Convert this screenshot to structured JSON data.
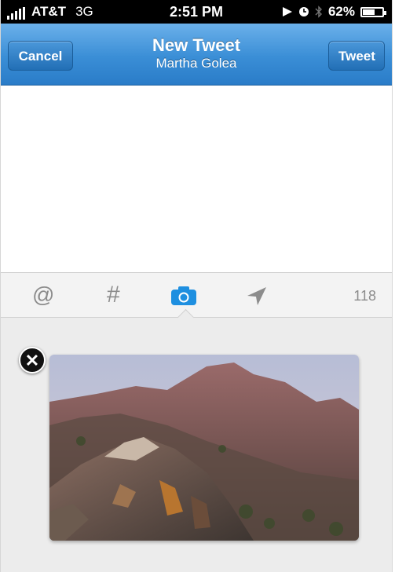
{
  "status_bar": {
    "carrier": "AT&T",
    "network": "3G",
    "time": "2:51 PM",
    "battery_percent": "62%",
    "battery_level": 0.62,
    "icons": [
      "signal-bars-icon",
      "location-arrow-icon",
      "alarm-clock-icon",
      "bluetooth-icon",
      "battery-icon"
    ]
  },
  "nav": {
    "cancel_label": "Cancel",
    "title": "New Tweet",
    "subtitle": "Martha Golea",
    "tweet_label": "Tweet"
  },
  "compose": {
    "text": ""
  },
  "toolbar": {
    "mention_symbol": "@",
    "hashtag_symbol": "#",
    "icons": [
      "at-mention-icon",
      "hashtag-icon",
      "camera-icon",
      "location-arrow-icon"
    ],
    "selected": "camera-icon",
    "char_count": "118"
  },
  "attachment": {
    "remove_icon": "close-x-icon",
    "image": "mountain-photo"
  },
  "colors": {
    "nav_blue": "#3a8ed6",
    "accent_camera": "#1e8fe0",
    "toolbar_icon_gray": "#8c8c8c"
  }
}
